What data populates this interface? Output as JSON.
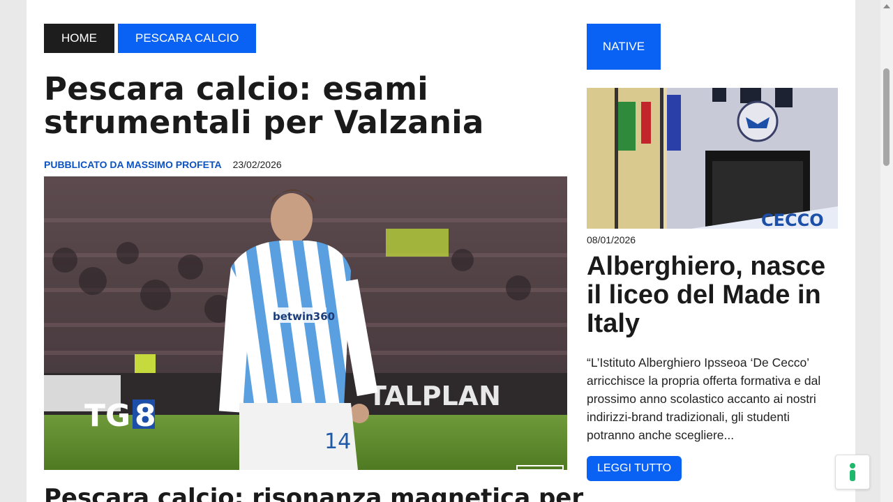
{
  "breadcrumb": {
    "home": "HOME",
    "category": "PESCARA CALCIO"
  },
  "article": {
    "title": "Pescara calcio: esami strumentali per Valzania",
    "author": "PUBBLICATO DA MASSIMO PROFETA",
    "date": "23/02/2026",
    "image": {
      "watermark_main": "TG",
      "watermark_digit": "8",
      "jersey_sponsor": "betwin360",
      "jersey_number": "14",
      "board_text": "TALPLAN"
    },
    "next_title": "Pescara calcio: risonanza magnetica per"
  },
  "sidebar": {
    "native_label": "NATIVE",
    "post": {
      "image_text": "CECCO",
      "date": "08/01/2026",
      "title": "Alberghiero, nasce il liceo del Made in Italy",
      "excerpt": "“L’Istituto Alberghiero Ipsseoa ‘De Cecco’ arricchisce la propria offerta formativa e dal prossimo anno scolastico accanto ai nostri indirizzi-brand tradizionali, gli studenti potranno anche scegliere...",
      "read_more": "LEGGI TUTTO"
    }
  },
  "colors": {
    "accent_blue": "#0a62f5",
    "dark": "#1d1d1d",
    "author_blue": "#0a52c2"
  },
  "icons": {
    "accessibility": "accessibility-icon"
  }
}
